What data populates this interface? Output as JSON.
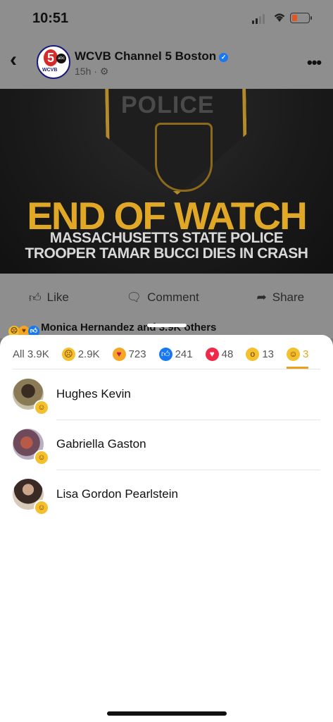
{
  "status": {
    "time": "10:51"
  },
  "header": {
    "page_name": "WCVB Channel 5 Boston",
    "age": "15h",
    "logo_number": "5",
    "logo_abc": "abc",
    "logo_wcvb": "WCVB"
  },
  "photo": {
    "patch_text": "POLICE",
    "headline": "END OF WATCH",
    "sub1": "MASSACHUSETTS STATE POLICE",
    "sub2": "TROOPER TAMAR BUCCI DIES IN CRASH"
  },
  "actions": {
    "like": "Like",
    "comment": "Comment",
    "share": "Share"
  },
  "reactions_summary": "Monica Hernandez and 3.9K others",
  "tabs": [
    {
      "label": "All 3.9K",
      "count": "3.9K",
      "icon": "none"
    },
    {
      "count": "2.9K",
      "icon": "sad-icon",
      "color": "#f5c02d"
    },
    {
      "count": "723",
      "icon": "care-icon",
      "color": "#f5a623"
    },
    {
      "count": "241",
      "icon": "like-icon",
      "color": "#1877f2"
    },
    {
      "count": "48",
      "icon": "love-icon",
      "color": "#f0284a"
    },
    {
      "count": "13",
      "icon": "wow-icon",
      "color": "#f5c02d"
    },
    {
      "count": "3",
      "icon": "haha-icon",
      "color": "#f5c02d"
    }
  ],
  "active_tab_color": "#e9a21e",
  "users": [
    {
      "name": "Hughes Kevin",
      "reaction": "haha-icon"
    },
    {
      "name": "Gabriella Gaston",
      "reaction": "haha-icon"
    },
    {
      "name": "Lisa Gordon Pearlstein",
      "reaction": "haha-icon"
    }
  ]
}
